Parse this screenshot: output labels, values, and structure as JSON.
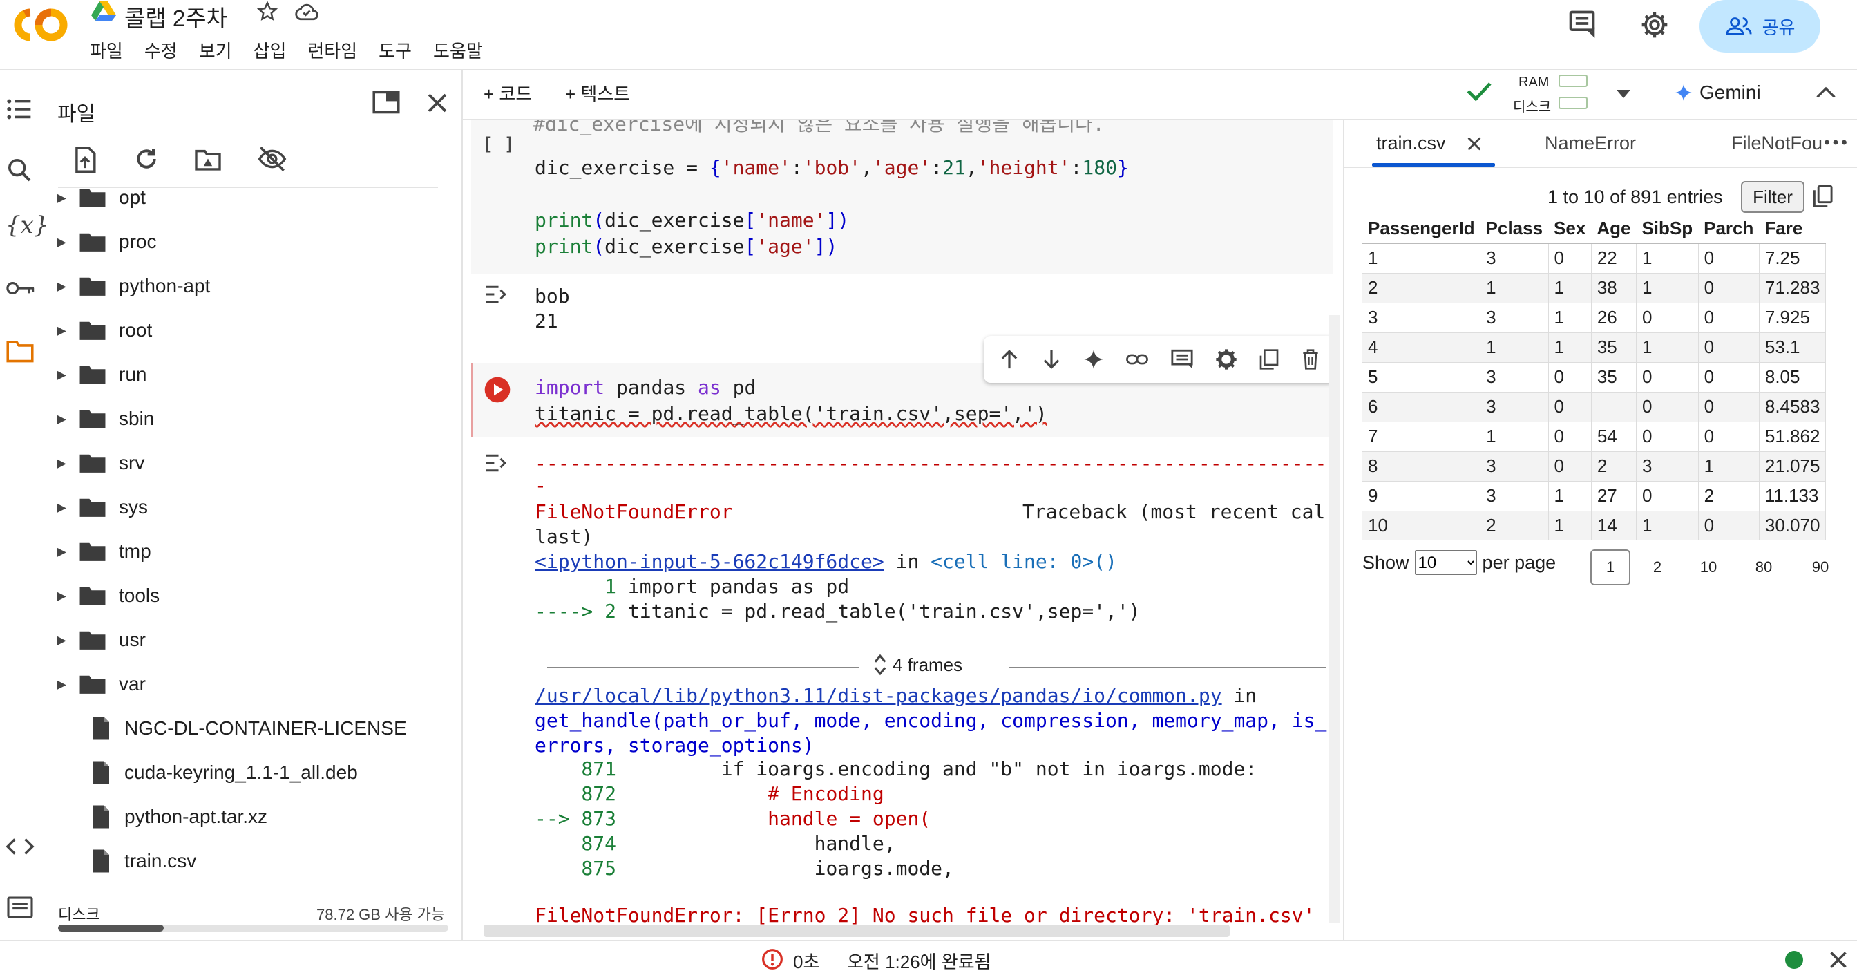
{
  "header": {
    "title": "콜랩 2주차",
    "menu": [
      "파일",
      "수정",
      "보기",
      "삽입",
      "런타임",
      "도구",
      "도움말"
    ],
    "share_label": "공유"
  },
  "files": {
    "title": "파일",
    "folders": [
      "opt",
      "proc",
      "python-apt",
      "root",
      "run",
      "sbin",
      "srv",
      "sys",
      "tmp",
      "tools",
      "usr",
      "var"
    ],
    "files": [
      "NGC-DL-CONTAINER-LICENSE",
      "cuda-keyring_1.1-1_all.deb",
      "python-apt.tar.xz",
      "train.csv"
    ],
    "disk_label": "디스크",
    "disk_free": "78.72 GB 사용 가능",
    "disk_used_fraction": 0.27
  },
  "toolbar": {
    "add_code": "+ 코드",
    "add_text": "+ 텍스트",
    "ram_label": "RAM",
    "disk_label": "디스크",
    "gemini_label": "Gemini"
  },
  "notebook": {
    "cell1_prompt": "[ ]",
    "cell1_comment": "#dic_exercise에 지정되지 않은 요소를 사용 실행을 해봅니다.",
    "cell1_code_var": "dic_exercise = ",
    "cell1_print1_a": "print",
    "cell1_print1_b": "(dic_exercise[",
    "cell1_print1_c": "'name'",
    "cell1_print1_d": "])",
    "cell1_print2_c": "'age'",
    "output1": [
      "bob",
      "21"
    ],
    "cell2_line1_import": "import",
    "cell2_line1_mid": " pandas ",
    "cell2_line1_as": "as",
    "cell2_line1_end": " pd",
    "cell2_line2": "titanic = pd.read_table('train.csv',sep=',')",
    "err_dashes": "---------------------------------------------------------------------------",
    "err_dash2": "-",
    "err_name": "FileNotFoundError",
    "err_traceback": "Traceback (most recent cal",
    "err_last": "last)",
    "err_input_link": "<ipython-input-5-662c149f6dce>",
    "err_in": " in ",
    "err_cell_line": "<cell line: 0>()",
    "err_l1_num": "      1 ",
    "err_l1_code": "import pandas as pd",
    "err_l2_arrow": "----> 2 ",
    "err_l2_code": "titanic = pd.read_table('train.csv',sep=',')",
    "frames_label": "4 frames",
    "path_link": "/usr/local/lib/python3.11/dist-packages/pandas/io/common.py",
    "path_in": " in",
    "get_handle": "get_handle(path_or_buf, mode, encoding, compression, memory_map, is_",
    "get_handle2": "errors, storage_options)",
    "src": [
      {
        "num": "    871",
        "code": "         if ioargs.encoding and \"b\" not in ioargs.mode:"
      },
      {
        "num": "    872",
        "code": "             # Encoding"
      },
      {
        "num": "--> 873",
        "code": "             handle = open("
      },
      {
        "num": "    874",
        "code": "                 handle,"
      },
      {
        "num": "    875",
        "code": "                 ioargs.mode,"
      }
    ],
    "err_final": "FileNotFoundError: [Errno 2] No such file or directory: 'train.csv'"
  },
  "right_panel": {
    "tabs": [
      "train.csv",
      "NameError",
      "FileNotFou"
    ],
    "entries_text": "1 to 10 of 891 entries",
    "filter_label": "Filter",
    "columns": [
      "PassengerId",
      "Pclass",
      "Sex",
      "Age",
      "SibSp",
      "Parch",
      "Fare"
    ],
    "rows": [
      [
        "1",
        "3",
        "0",
        "22",
        "1",
        "0",
        "7.25"
      ],
      [
        "2",
        "1",
        "1",
        "38",
        "1",
        "0",
        "71.283"
      ],
      [
        "3",
        "3",
        "1",
        "26",
        "0",
        "0",
        "7.925"
      ],
      [
        "4",
        "1",
        "1",
        "35",
        "1",
        "0",
        "53.1"
      ],
      [
        "5",
        "3",
        "0",
        "35",
        "0",
        "0",
        "8.05"
      ],
      [
        "6",
        "3",
        "0",
        "",
        "0",
        "0",
        "8.4583"
      ],
      [
        "7",
        "1",
        "0",
        "54",
        "0",
        "0",
        "51.862"
      ],
      [
        "8",
        "3",
        "0",
        "2",
        "3",
        "1",
        "21.075"
      ],
      [
        "9",
        "3",
        "1",
        "27",
        "0",
        "2",
        "11.133"
      ],
      [
        "10",
        "2",
        "1",
        "14",
        "1",
        "0",
        "30.070"
      ]
    ],
    "show_label": "Show",
    "show_value": "10",
    "per_page": "per page",
    "pages": [
      "1",
      "2",
      "10",
      "80",
      "90"
    ]
  },
  "status": {
    "elapsed": "0초",
    "completed": "오전 1:26에 완료됨"
  },
  "colors": {
    "accent": "#0b57d0",
    "share_bg": "#c2e7ff",
    "run_red": "#d93025",
    "status_green": "#1e8e3e",
    "folder_orange": "#e37400"
  }
}
